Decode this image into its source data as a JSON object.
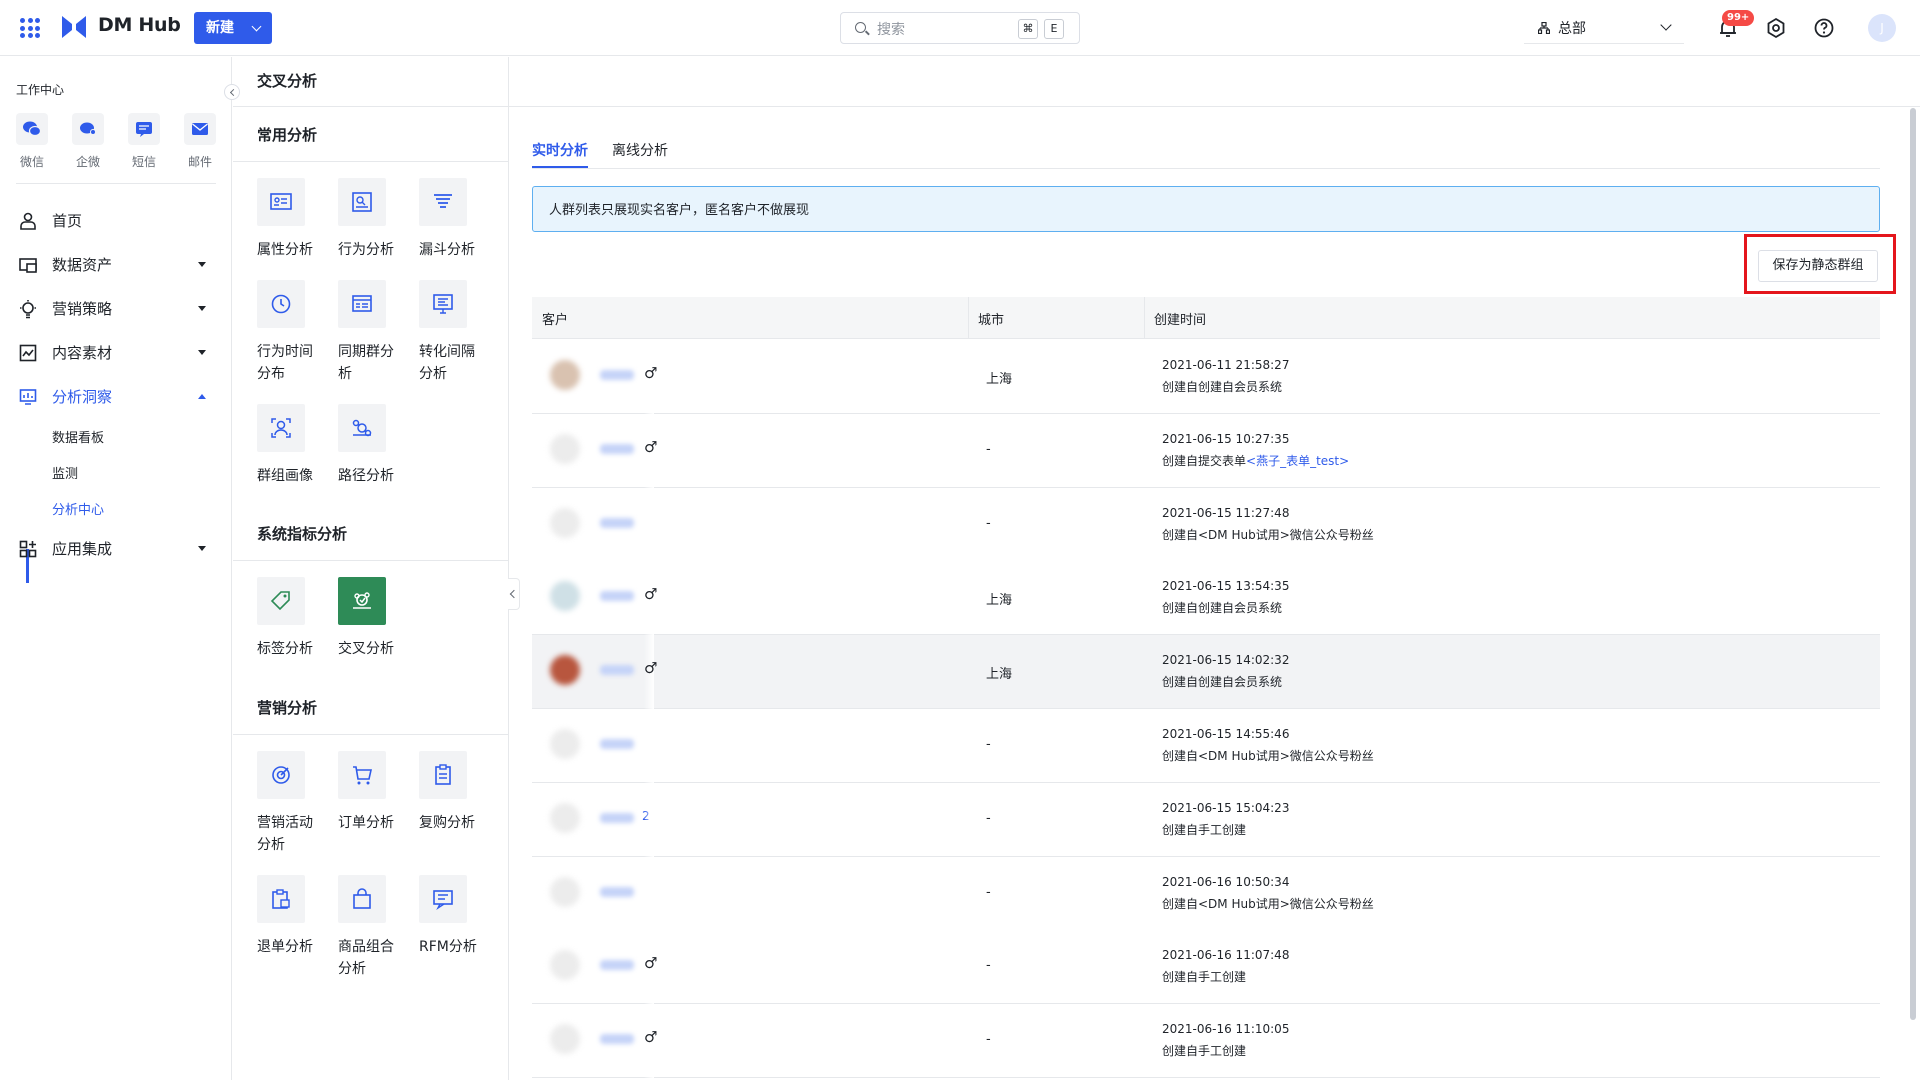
{
  "topbar": {
    "brand": "DM Hub",
    "new_label": "新建",
    "search_placeholder": "搜索",
    "kbd_cmd": "⌘",
    "kbd_e": "E",
    "org_label": "总部",
    "notify_badge": "99+",
    "avatar_text": "J"
  },
  "sidebar": {
    "workspace_title": "工作中心",
    "channels": [
      {
        "label": "微信",
        "icon": "wechat-icon"
      },
      {
        "label": "企微",
        "icon": "wecom-icon"
      },
      {
        "label": "短信",
        "icon": "sms-icon"
      },
      {
        "label": "邮件",
        "icon": "mail-icon"
      }
    ],
    "items": [
      {
        "label": "首页",
        "icon": "home-icon"
      },
      {
        "label": "数据资产",
        "icon": "data-assets-icon"
      },
      {
        "label": "营销策略",
        "icon": "bulb-icon"
      },
      {
        "label": "内容素材",
        "icon": "content-icon"
      },
      {
        "label": "分析洞察",
        "icon": "analytics-icon"
      },
      {
        "label": "应用集成",
        "icon": "apps-icon"
      }
    ],
    "sub_items": [
      "数据看板",
      "监测",
      "分析中心"
    ]
  },
  "breadcrumb": "交叉分析",
  "analysis_panel": {
    "common_title": "常用分析",
    "common": [
      {
        "label": "属性分析"
      },
      {
        "label": "行为分析"
      },
      {
        "label": "漏斗分析"
      },
      {
        "label": "行为时间分布"
      },
      {
        "label": "同期群分析"
      },
      {
        "label": "转化间隔分析"
      },
      {
        "label": "群组画像"
      },
      {
        "label": "路径分析"
      }
    ],
    "system_title": "系统指标分析",
    "system": [
      {
        "label": "标签分析"
      },
      {
        "label": "交叉分析"
      }
    ],
    "marketing_title": "营销分析",
    "marketing": [
      {
        "label": "营销活动分析"
      },
      {
        "label": "订单分析"
      },
      {
        "label": "复购分析"
      },
      {
        "label": "退单分析"
      },
      {
        "label": "商品组合分析"
      },
      {
        "label": "RFM分析"
      }
    ]
  },
  "main": {
    "tabs": [
      "实时分析",
      "离线分析"
    ],
    "notice": "人群列表只展现实名客户，匿名客户不做展现",
    "save_button": "保存为静态群组",
    "columns": [
      "客户",
      "城市",
      "创建时间"
    ],
    "rows": [
      {
        "gender": "♂",
        "city": "上海",
        "time": "2021-06-11 21:58:27",
        "source": "创建自创建自会员系统",
        "source_link": "",
        "name_suffix": ""
      },
      {
        "gender": "♂",
        "city": "-",
        "time": "2021-06-15 10:27:35",
        "source": "创建自提交表单",
        "source_link": "<燕子_表单_test>",
        "name_suffix": ""
      },
      {
        "gender": "",
        "city": "-",
        "time": "2021-06-15 11:27:48",
        "source": "创建自<DM Hub试用>微信公众号粉丝",
        "source_link": "",
        "name_suffix": ""
      },
      {
        "gender": "♂",
        "city": "上海",
        "time": "2021-06-15 13:54:35",
        "source": "创建自创建自会员系统",
        "source_link": "",
        "name_suffix": ""
      },
      {
        "gender": "♂",
        "city": "上海",
        "time": "2021-06-15 14:02:32",
        "source": "创建自创建自会员系统",
        "source_link": "",
        "name_suffix": ""
      },
      {
        "gender": "",
        "city": "-",
        "time": "2021-06-15 14:55:46",
        "source": "创建自<DM Hub试用>微信公众号粉丝",
        "source_link": "",
        "name_suffix": ""
      },
      {
        "gender": "",
        "city": "-",
        "time": "2021-06-15 15:04:23",
        "source": "创建自手工创建",
        "source_link": "",
        "name_suffix": "2"
      },
      {
        "gender": "",
        "city": "-",
        "time": "2021-06-16 10:50:34",
        "source": "创建自<DM Hub试用>微信公众号粉丝",
        "source_link": "",
        "name_suffix": ""
      },
      {
        "gender": "♂",
        "city": "-",
        "time": "2021-06-16 11:07:48",
        "source": "创建自手工创建",
        "source_link": "",
        "name_suffix": ""
      },
      {
        "gender": "♂",
        "city": "-",
        "time": "2021-06-16 11:10:05",
        "source": "创建自手工创建",
        "source_link": "",
        "name_suffix": ""
      }
    ]
  },
  "colors": {
    "accent": "#2f5bea",
    "selected_tool": "#2e8b57",
    "highlight": "#e4161c",
    "notice_bg": "#e8f4fd",
    "notice_border": "#5eaff0"
  }
}
